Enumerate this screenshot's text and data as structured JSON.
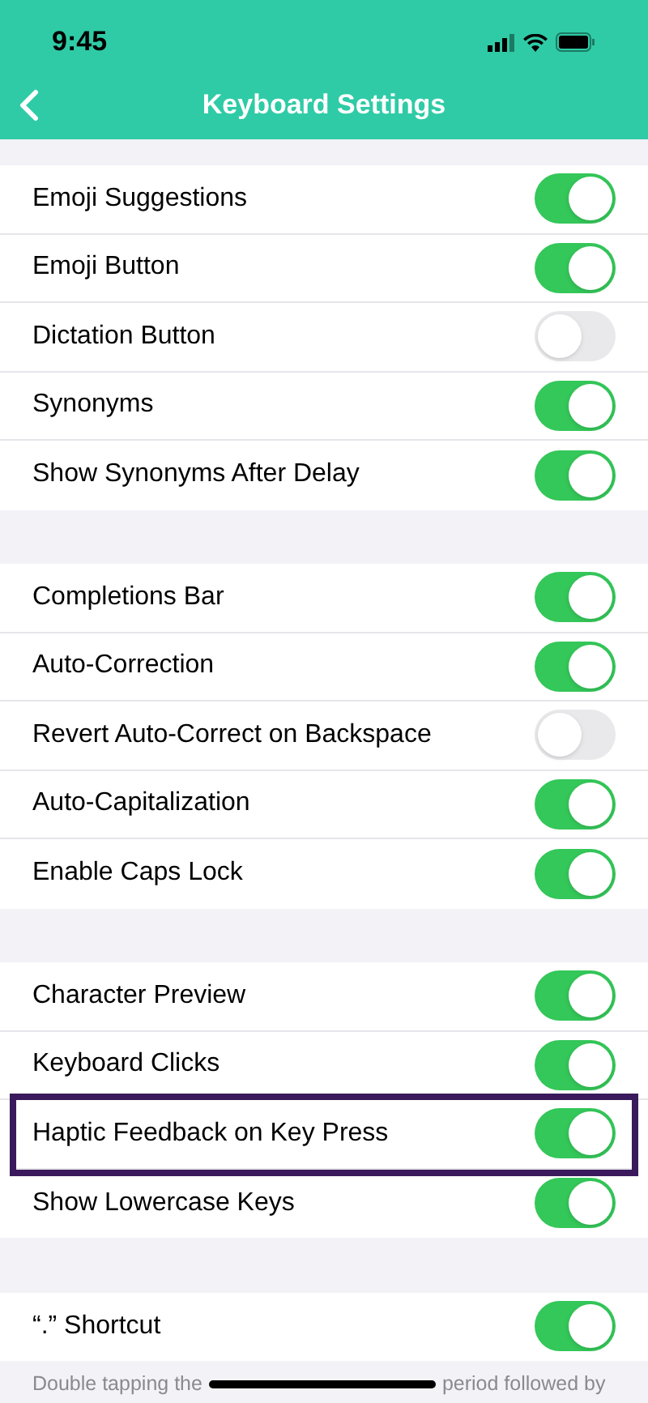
{
  "status_bar": {
    "time": "9:45"
  },
  "nav": {
    "title": "Keyboard Settings"
  },
  "groups": [
    {
      "rows": [
        {
          "label": "Emoji Suggestions",
          "on": true,
          "highlighted": false
        },
        {
          "label": "Emoji Button",
          "on": true,
          "highlighted": false
        },
        {
          "label": "Dictation Button",
          "on": false,
          "highlighted": false
        },
        {
          "label": "Synonyms",
          "on": true,
          "highlighted": false
        },
        {
          "label": "Show Synonyms After Delay",
          "on": true,
          "highlighted": false
        }
      ]
    },
    {
      "rows": [
        {
          "label": "Completions Bar",
          "on": true,
          "highlighted": false
        },
        {
          "label": "Auto-Correction",
          "on": true,
          "highlighted": false
        },
        {
          "label": "Revert Auto-Correct on Backspace",
          "on": false,
          "highlighted": false
        },
        {
          "label": "Auto-Capitalization",
          "on": true,
          "highlighted": false
        },
        {
          "label": "Enable Caps Lock",
          "on": true,
          "highlighted": false
        }
      ]
    },
    {
      "rows": [
        {
          "label": "Character Preview",
          "on": true,
          "highlighted": false
        },
        {
          "label": "Keyboard Clicks",
          "on": true,
          "highlighted": false
        },
        {
          "label": "Haptic Feedback on Key Press",
          "on": true,
          "highlighted": true
        },
        {
          "label": "Show Lowercase Keys",
          "on": true,
          "highlighted": false
        }
      ]
    },
    {
      "rows": [
        {
          "label": "“.” Shortcut",
          "on": true,
          "highlighted": false
        }
      ],
      "footer": [
        "Double tapping the",
        "period followed by"
      ]
    }
  ]
}
